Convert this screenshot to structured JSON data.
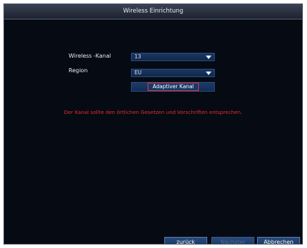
{
  "dialog": {
    "title": "Wireless Einrichtung"
  },
  "fields": {
    "channel_label": "Wireless -Kanal",
    "channel_value": "13",
    "region_label": "Region",
    "region_value": "EU"
  },
  "adaptive_button_label": "Adaptiver Kanal",
  "warning_text": "Der Kanal sollte den örtlichen Gesetzen und Vorschriften entsprechen.",
  "buttons": {
    "back": "zurück",
    "next": "Nächster",
    "cancel": "Abbrechen"
  },
  "colors": {
    "background": "#060a13",
    "warning": "#e3302e",
    "focus_border": "#e5363b",
    "control": "#1b3766"
  }
}
